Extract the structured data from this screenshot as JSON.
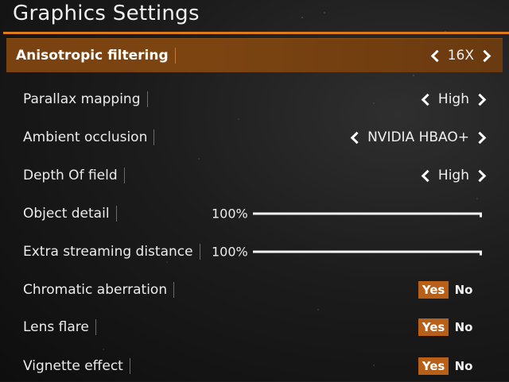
{
  "header": {
    "title": "Graphics Settings"
  },
  "colors": {
    "accent": "#e07a1f",
    "selected_row": "#7a4210",
    "toggle_on": "#b85f1a"
  },
  "settings": [
    {
      "id": "anisotropic-filtering",
      "label": "Anisotropic filtering",
      "type": "selector",
      "value": "16X",
      "active": true
    },
    {
      "id": "parallax-mapping",
      "label": "Parallax mapping",
      "type": "selector",
      "value": "High"
    },
    {
      "id": "ambient-occlusion",
      "label": "Ambient occlusion",
      "type": "selector",
      "value": "NVIDIA HBAO+"
    },
    {
      "id": "depth-of-field",
      "label": "Depth Of field",
      "type": "selector",
      "value": "High"
    },
    {
      "id": "object-detail",
      "label": "Object detail",
      "type": "slider",
      "value_text": "100%",
      "level": 1.0
    },
    {
      "id": "extra-streaming-distance",
      "label": "Extra streaming distance",
      "type": "slider",
      "value_text": "100%",
      "level": 1.0
    },
    {
      "id": "chromatic-aberration",
      "label": "Chromatic aberration",
      "type": "toggle",
      "on_label": "Yes",
      "off_label": "No",
      "selected": "Yes"
    },
    {
      "id": "lens-flare",
      "label": "Lens flare",
      "type": "toggle",
      "on_label": "Yes",
      "off_label": "No",
      "selected": "Yes"
    },
    {
      "id": "vignette-effect",
      "label": "Vignette effect",
      "type": "toggle",
      "on_label": "Yes",
      "off_label": "No",
      "selected": "Yes"
    }
  ]
}
